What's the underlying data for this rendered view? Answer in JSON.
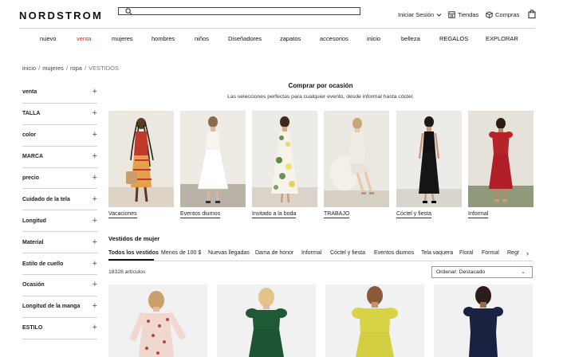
{
  "header": {
    "logo": "NORDSTROM",
    "search_placeholder": "",
    "signin": "Iniciar Sesión",
    "stores": "Tiendas",
    "orders": "Compras"
  },
  "nav": {
    "items": [
      "nuevo",
      "venta",
      "mujeres",
      "hombres",
      "niños",
      "Diseñadores",
      "zapatos",
      "accesorios",
      "inicio",
      "belleza",
      "REGALOS",
      "EXPLORAR"
    ]
  },
  "breadcrumb": [
    "inicio",
    "mujeres",
    "ropa",
    "VESTIDOS"
  ],
  "filters": [
    "venta",
    "TALLA",
    "color",
    "MARCA",
    "precio",
    "Cuidado de la tela",
    "Longitud",
    "Material",
    "Estilo de cuello",
    "Ocasión",
    "Longitud de la manga",
    "ESTILO"
  ],
  "occasion": {
    "title": "Comprar por ocasión",
    "subtitle": "Las selecciones perfectas para cualquier evento, desde informal hasta cóctel.",
    "cards": [
      {
        "label": "Vacaciones"
      },
      {
        "label": "Eventos diurnos"
      },
      {
        "label": "Invitado a la boda"
      },
      {
        "label": "TRABAJO"
      },
      {
        "label": "Cóctel y fiesta"
      },
      {
        "label": "Informal"
      }
    ]
  },
  "dresses": {
    "title": "Vestidos de mujer",
    "tabs": [
      "Todos los vestidos",
      "Menos de 100 $",
      "Nuevas llegadas",
      "Dama de honor",
      "Informal",
      "Cóctel y fiesta",
      "Eventos diurnos",
      "Tela vaquera",
      "Floral",
      "Formal",
      "Regr"
    ],
    "count": "18328 artículos",
    "sort": "Ordenar: Destacado"
  },
  "colors": {
    "sale": "#c0311f",
    "text": "#111111"
  }
}
